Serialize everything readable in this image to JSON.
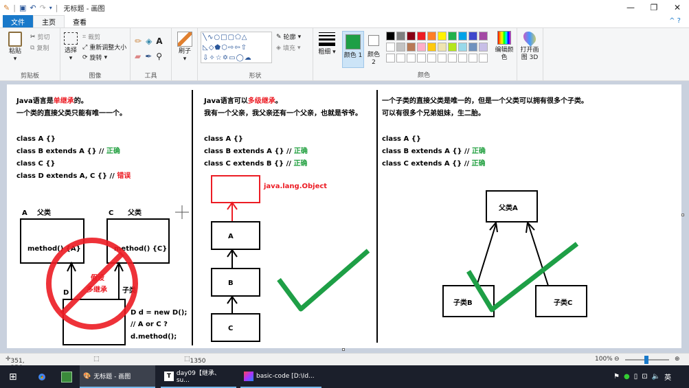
{
  "window": {
    "title": "无标题 - 画图",
    "controls": {
      "minimize": "—",
      "maximize": "❐",
      "close": "✕"
    }
  },
  "menu": {
    "file": "文件",
    "home": "主页",
    "view": "查看",
    "help": "^ ?"
  },
  "ribbon": {
    "clipboard": {
      "paste": "粘贴",
      "cut": "剪切",
      "copy": "复制",
      "label": "剪贴板"
    },
    "image": {
      "select": "选择",
      "crop": "裁剪",
      "resize": "重新调整大小",
      "rotate": "旋转",
      "label": "图像"
    },
    "tools": {
      "label": "工具"
    },
    "brushes": {
      "label": "刷子"
    },
    "shapes": {
      "outline": "轮廓",
      "fill": "填充",
      "label": "形状"
    },
    "size": {
      "label": "粗细"
    },
    "color1": {
      "label": "颜色 1",
      "value": "#1e9f46"
    },
    "color2": {
      "label": "颜色 2",
      "value": "#ffffff"
    },
    "colors": {
      "label": "颜色",
      "palette_row1": [
        "#000000",
        "#7f7f7f",
        "#880015",
        "#ed1c24",
        "#ff7f27",
        "#fff200",
        "#22b14c",
        "#00a2e8",
        "#3f48cc",
        "#a349a4"
      ],
      "palette_row2": [
        "#ffffff",
        "#c3c3c3",
        "#b97a57",
        "#ffaec9",
        "#ffc90e",
        "#efe4b0",
        "#b5e61d",
        "#99d9ea",
        "#7092be",
        "#c8bfe7"
      ],
      "edit": "编辑颜色"
    },
    "paint3d": {
      "label": "打开画图 3D"
    }
  },
  "canvas_content": {
    "col1": {
      "line1a": "Java语言是",
      "line1b": "单继承",
      "line1c": "的。",
      "line2": "一个类的直接父类只能有唯一一个。",
      "code1": "class A {}",
      "code2a": "class B extends A {} // ",
      "code2b": "正确",
      "code3": "class C {}",
      "code4a": "class D extends A, C {} // ",
      "code4b": "错误",
      "labelA": "A",
      "labelParent1": "父类",
      "labelC": "C",
      "labelParent2": "父类",
      "methodA": "method() {A}",
      "methodC": "method() {C}",
      "labelD": "D",
      "labelChild": "子类",
      "assume": "假设",
      "multi": "多继承",
      "dcode1": "D d = new D();",
      "dcode2": "// A or C ?",
      "dcode3": "d.method();"
    },
    "col2": {
      "line1a": "Java语言可以",
      "line1b": "多级继承",
      "line1c": "。",
      "line2": "我有一个父亲，我父亲还有一个父亲，也就是爷爷。",
      "code1": "class A {}",
      "code2a": "class B extends A {} // ",
      "code2b": "正确",
      "code3a": "class C extends B {} // ",
      "code3b": "正确",
      "objectLabel": "java.lang.Object",
      "boxA": "A",
      "boxB": "B",
      "boxC": "C"
    },
    "col3": {
      "line1": "一个子类的直接父类是唯一的，但是一个父类可以拥有很多个子类。",
      "line2": "可以有很多个兄弟姐妹，生二胎。",
      "code1": "class A {}",
      "code2a": "class B extends A {} // ",
      "code2b": "正确",
      "code3a": "class C extends A {} // ",
      "code3b": "正确",
      "parent": "父类A",
      "childB": "子类B",
      "childC": "子类C"
    }
  },
  "status": {
    "cursor": "351, 256像素",
    "size": "1350 × 530像素",
    "zoom": "100%"
  },
  "taskbar": {
    "paint": "无标题 - 画图",
    "typora": "day09【继承、su...",
    "idea": "basic-code [D:\\Id...",
    "ime": "英"
  }
}
